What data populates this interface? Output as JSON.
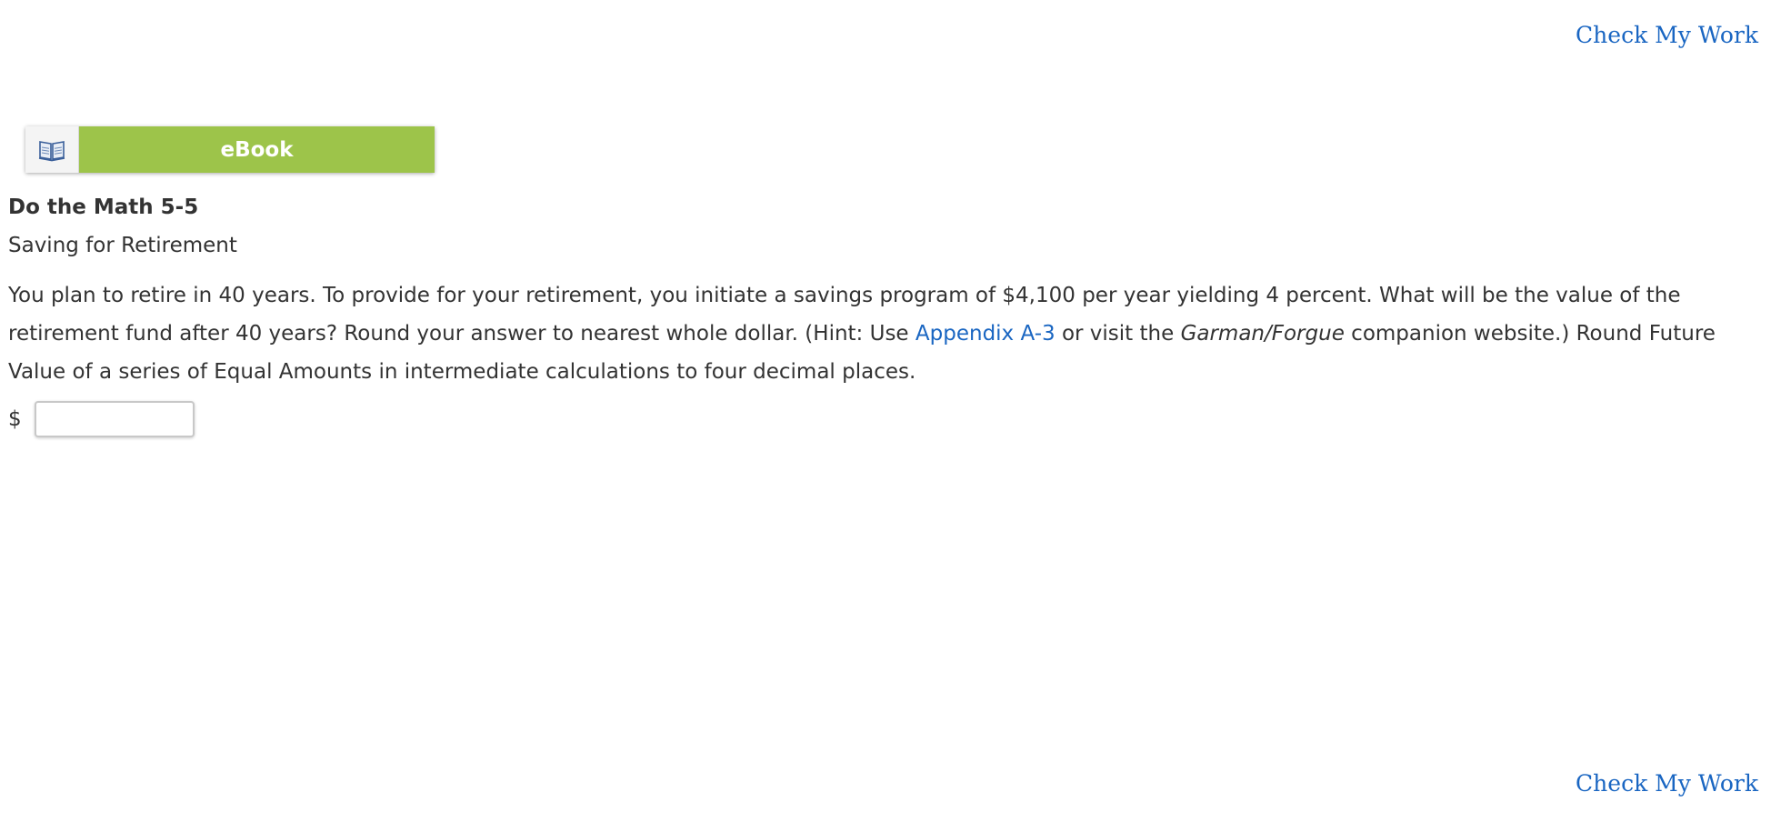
{
  "header": {
    "check_work_top": "Check My Work"
  },
  "ebook": {
    "label": "eBook",
    "icon": "open-book-icon"
  },
  "problem": {
    "title": "Do the Math 5-5",
    "subtitle": "Saving for Retirement",
    "text_part1": "You plan to retire in 40 years. To provide for your retirement, you initiate a savings program of $4,100 per year yielding 4 percent. What will be the value of the retirement fund after 40 years? Round your answer to nearest whole dollar. (Hint: Use ",
    "appendix_link": "Appendix A-3",
    "text_part2": " or visit the ",
    "website_name": "Garman/Forgue",
    "text_part3": " companion website.) Round Future Value of a series of Equal Amounts in intermediate calculations to four decimal places."
  },
  "answer": {
    "currency_symbol": "$",
    "value": "",
    "placeholder": ""
  },
  "footer": {
    "check_work_bottom": "Check My Work"
  },
  "colors": {
    "link": "#1a66c2",
    "ebook_green": "#9dc44a",
    "text": "#333333"
  }
}
